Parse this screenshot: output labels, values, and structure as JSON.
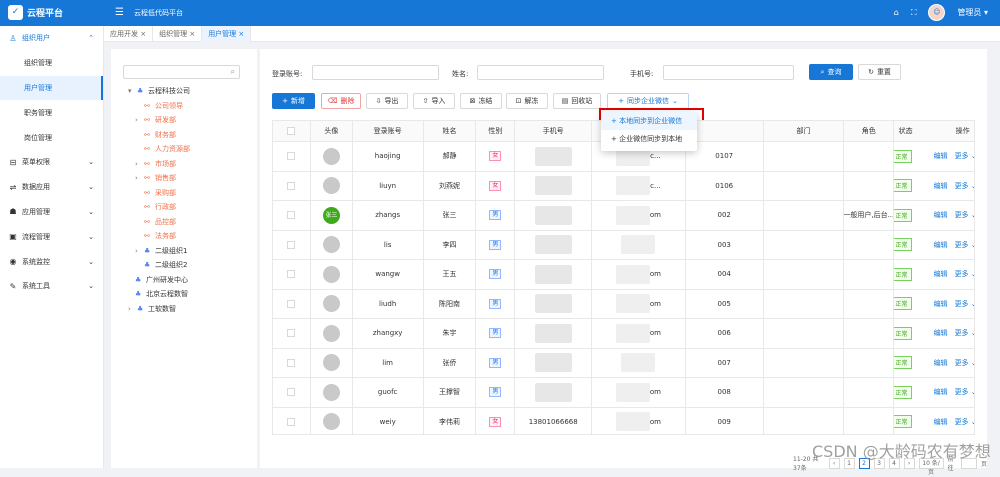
{
  "app": {
    "logo_text": "云程平台",
    "logo_icon": "logo-box",
    "top_title": "云程低代码平台",
    "home_icon": "⌂",
    "fullscreen_icon": "⛶",
    "user_avatar": "☺",
    "user_name": "管理员"
  },
  "sidebar": {
    "parent": "组织用户",
    "sub_items": [
      "组织管理",
      "用户管理",
      "职务管理",
      "岗位管理"
    ],
    "items": [
      {
        "icon": "⊟",
        "label": "菜单权限"
      },
      {
        "icon": "⇌",
        "label": "数据应用"
      },
      {
        "icon": "☗",
        "label": "应用管理"
      },
      {
        "icon": "▣",
        "label": "流程管理"
      },
      {
        "icon": "◉",
        "label": "系统监控"
      },
      {
        "icon": "✎",
        "label": "系统工具"
      }
    ]
  },
  "tabs": [
    {
      "label": "应用开发 ×"
    },
    {
      "label": "组织管理 ×"
    },
    {
      "label": "用户管理 ×"
    }
  ],
  "tree": {
    "search_placeholder": "",
    "nodes": [
      "云程科技公司",
      "公司领导",
      "研发部",
      "财务部",
      "人力资源部",
      "市场部",
      "销售部",
      "采购部",
      "行政部",
      "品控部",
      "法务部",
      "二级组织1",
      "二级组织2",
      "广州研发中心",
      "北京云程数智",
      "工软数智"
    ]
  },
  "filters": {
    "login_label": "登录账号:",
    "name_label": "姓名:",
    "phone_label": "手机号:",
    "query_label": "查询",
    "reset_label": "重置"
  },
  "toolbar": {
    "add": "新增",
    "delete": "删除",
    "export": "导出",
    "import": "导入",
    "freeze": "冻结",
    "unfreeze": "解冻",
    "recycle": "回收站",
    "sync": "同步企业微信"
  },
  "dropdown": {
    "item1": "本地同步到企业微信",
    "item2": "企业微信同步到本地"
  },
  "table": {
    "headers": [
      "",
      "头像",
      "登录账号",
      "姓名",
      "性别",
      "手机号",
      "",
      "",
      "部门",
      "角色",
      "状态",
      "操作"
    ],
    "rows": [
      {
        "avatar": "",
        "login": "haojing",
        "name": "郝静",
        "gender": "女",
        "phone_tail": "c...",
        "code": "0107",
        "dept": "",
        "role": "",
        "status": "正常",
        "edit": "编辑",
        "more": "更多 ⌄"
      },
      {
        "avatar": "",
        "login": "liuyn",
        "name": "刘燕妮",
        "gender": "女",
        "phone_tail": "c...",
        "code": "0106",
        "dept": "",
        "role": "",
        "status": "正常",
        "edit": "编辑",
        "more": "更多 ⌄"
      },
      {
        "avatar": "张三",
        "login": "zhangs",
        "name": "张三",
        "gender": "男",
        "phone_tail": "om",
        "code": "002",
        "dept": "",
        "role": "一般用户,后台...",
        "status": "正常",
        "edit": "编辑",
        "more": "更多 ⌄"
      },
      {
        "avatar": "",
        "login": "lis",
        "name": "李四",
        "gender": "男",
        "phone_tail": "",
        "code": "003",
        "dept": "",
        "role": "",
        "status": "正常",
        "edit": "编辑",
        "more": "更多 ⌄"
      },
      {
        "avatar": "",
        "login": "wangw",
        "name": "王五",
        "gender": "男",
        "phone_tail": "om",
        "code": "004",
        "dept": "",
        "role": "",
        "status": "正常",
        "edit": "编辑",
        "more": "更多 ⌄"
      },
      {
        "avatar": "",
        "login": "liudh",
        "name": "陈阳南",
        "gender": "男",
        "phone_tail": "om",
        "code": "005",
        "dept": "",
        "role": "",
        "status": "正常",
        "edit": "编辑",
        "more": "更多 ⌄"
      },
      {
        "avatar": "",
        "login": "zhangxy",
        "name": "朱宇",
        "gender": "男",
        "phone_tail": "om",
        "code": "006",
        "dept": "",
        "role": "",
        "status": "正常",
        "edit": "编辑",
        "more": "更多 ⌄"
      },
      {
        "avatar": "",
        "login": "lim",
        "name": "张侨",
        "gender": "男",
        "phone_tail": "",
        "code": "007",
        "dept": "",
        "role": "",
        "status": "正常",
        "edit": "编辑",
        "more": "更多 ⌄"
      },
      {
        "avatar": "",
        "login": "guofc",
        "name": "王撑智",
        "gender": "男",
        "phone_tail": "om",
        "code": "008",
        "dept": "",
        "role": "",
        "status": "正常",
        "edit": "编辑",
        "more": "更多 ⌄"
      },
      {
        "avatar": "",
        "login": "weiy",
        "name": "李伟莉",
        "gender": "女",
        "phone": "13801066668",
        "phone_tail": "om",
        "code": "009",
        "dept": "",
        "role": "",
        "status": "正常",
        "edit": "编辑",
        "more": "更多 ⌄"
      }
    ]
  },
  "pager": {
    "summary": "11-20 共37条",
    "prev": "‹",
    "page1": "1",
    "page2": "2",
    "page3": "3",
    "page4": "4",
    "next": "›",
    "size": "10 条/页",
    "jump": "前往",
    "page_label": "页"
  },
  "watermark": "CSDN @大龄码农有梦想"
}
